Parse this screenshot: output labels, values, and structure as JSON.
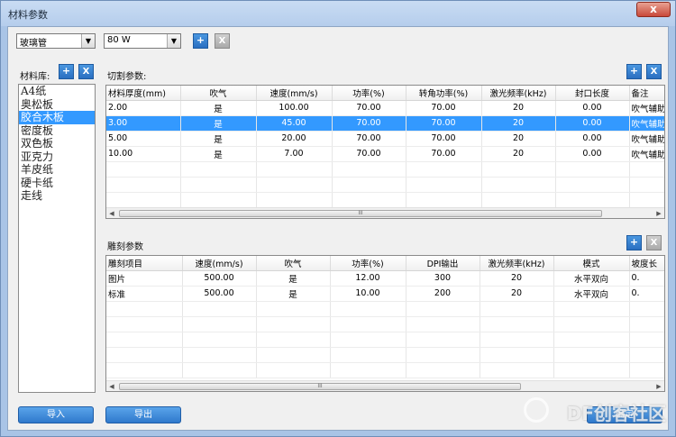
{
  "window": {
    "title": "材料参数",
    "close_label": "x"
  },
  "toolbar": {
    "tube_combo": "玻璃管",
    "power_combo": "80 W",
    "add_label": "+",
    "delete_label": "X"
  },
  "library": {
    "label": "材料库:",
    "items": [
      "A4纸",
      "奥松板",
      "胶合木板",
      "密度板",
      "双色板",
      "亚克力",
      "羊皮纸",
      "硬卡纸",
      "走线"
    ],
    "selected_index": 2
  },
  "cut": {
    "label": "切割参数:",
    "columns": [
      "材料厚度(mm)",
      "吹气",
      "速度(mm/s)",
      "功率(%)",
      "转角功率(%)",
      "激光频率(kHz)",
      "封口长度",
      "备注"
    ],
    "rows": [
      [
        "2.00",
        "是",
        "100.00",
        "70.00",
        "70.00",
        "20",
        "0.00",
        "吹气辅助"
      ],
      [
        "3.00",
        "是",
        "45.00",
        "70.00",
        "70.00",
        "20",
        "0.00",
        "吹气辅助"
      ],
      [
        "5.00",
        "是",
        "20.00",
        "70.00",
        "70.00",
        "20",
        "0.00",
        "吹气辅助"
      ],
      [
        "10.00",
        "是",
        "7.00",
        "70.00",
        "70.00",
        "20",
        "0.00",
        "吹气辅助"
      ]
    ],
    "selected_row": 1,
    "scroll_thumb": "III"
  },
  "engrave": {
    "label": "雕刻参数",
    "columns": [
      "雕刻项目",
      "速度(mm/s)",
      "吹气",
      "功率(%)",
      "DPI输出",
      "激光频率(kHz)",
      "模式",
      "坡度长"
    ],
    "rows": [
      [
        "图片",
        "500.00",
        "是",
        "12.00",
        "300",
        "20",
        "水平双向",
        "0."
      ],
      [
        "标准",
        "500.00",
        "是",
        "10.00",
        "200",
        "20",
        "水平双向",
        "0."
      ]
    ],
    "scroll_thumb": "III"
  },
  "footer": {
    "import_label": "导入",
    "export_label": "导出",
    "ok_label": "确定"
  },
  "watermark": "DF创客社区"
}
